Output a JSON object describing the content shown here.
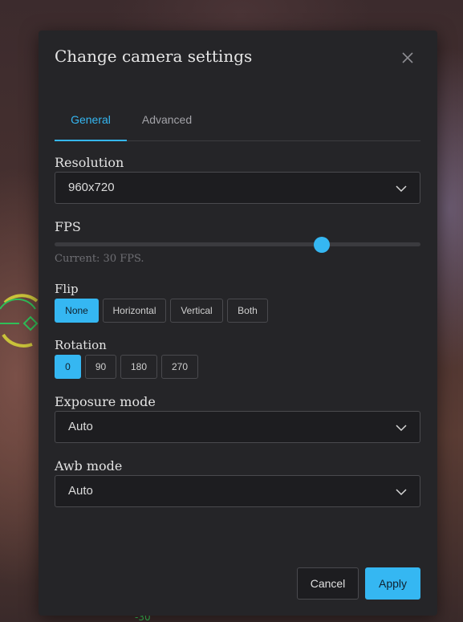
{
  "dialog": {
    "title": "Change camera settings",
    "close_icon": "close-icon"
  },
  "tabs": [
    {
      "label": "General",
      "active": true
    },
    {
      "label": "Advanced",
      "active": false
    }
  ],
  "resolution": {
    "label": "Resolution",
    "value": "960x720"
  },
  "fps": {
    "label": "FPS",
    "current_text": "Current: 30 FPS.",
    "value": 30,
    "slider_fraction": 0.73
  },
  "flip": {
    "label": "Flip",
    "options": [
      "None",
      "Horizontal",
      "Vertical",
      "Both"
    ],
    "selected": "None"
  },
  "rotation": {
    "label": "Rotation",
    "options": [
      "0",
      "90",
      "180",
      "270"
    ],
    "selected": "0"
  },
  "exposure_mode": {
    "label": "Exposure mode",
    "value": "Auto"
  },
  "awb_mode": {
    "label": "Awb mode",
    "value": "Auto"
  },
  "buttons": {
    "cancel": "Cancel",
    "apply": "Apply"
  },
  "background": {
    "hud_reading": "-30"
  },
  "colors": {
    "accent": "#35b7f2",
    "dialog_bg": "#252528",
    "hud_green": "#39c45a"
  }
}
